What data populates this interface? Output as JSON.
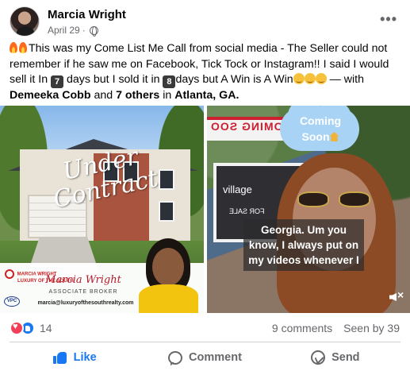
{
  "post": {
    "author": "Marcia Wright",
    "date": "April 29",
    "privacy_separator": "·",
    "more_label": "•••",
    "text": {
      "line_part1": "This was my Come List Me Call from social media - The Seller  could not remember if he saw me on Facebook, Tick Tock or Instagram!! I said I would sell it In ",
      "kbd1": "7",
      "line_part2": " days but I sold it in ",
      "kbd2": "8",
      "line_part3": "days but A Win is A Win",
      "with_prefix": " — with ",
      "tagged_person": "Demeeka Cobb",
      "and": " and ",
      "others": "7 others",
      "in": " in ",
      "location": "Atlanta, GA."
    }
  },
  "media": {
    "left": {
      "overlay_title": "Under Contract",
      "brand_line1": "MARCIA WRIGHT",
      "brand_line2": "LUXURY OF THE SOUTH",
      "vpc": "VPC",
      "agent_name": "Marcia Wright",
      "agent_title": "ASSOCIATE BROKER",
      "agent_email": "marcia@luxuryofthesouthrealty.com"
    },
    "right": {
      "cloud_line1": "Coming",
      "cloud_line2": "Soon",
      "banner_text": "COMING SOO",
      "sign_brand": "village",
      "sign_sale": "FOR SALE",
      "caption": "Georgia. Um you know, I always put on my videos whenever I"
    }
  },
  "engagement": {
    "reaction_count": "14",
    "comments": "9 comments",
    "seen_by": "Seen by 39"
  },
  "actions": {
    "like": "Like",
    "comment": "Comment",
    "send": "Send"
  },
  "colors": {
    "facebook_blue": "#1877f2",
    "secondary_text": "#65676b",
    "love_red": "#f33e58"
  }
}
